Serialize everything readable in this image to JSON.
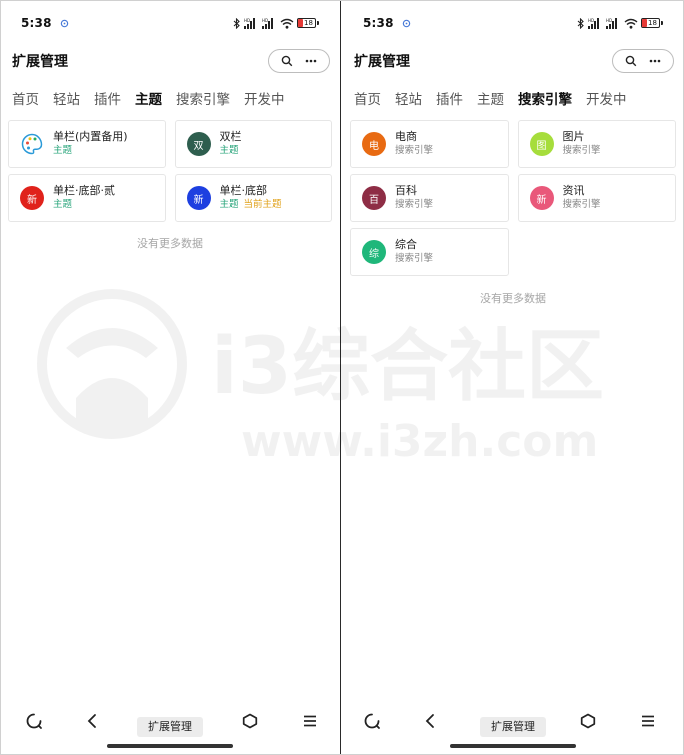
{
  "status_bar": {
    "time": "5:38",
    "battery": "18"
  },
  "app": {
    "title": "扩展管理"
  },
  "tabs": [
    "首页",
    "轻站",
    "插件",
    "主题",
    "搜索引擎",
    "开发中"
  ],
  "left_panel": {
    "active_tab": "主题",
    "cards": [
      {
        "name": "单栏(内置备用)",
        "sub": "主题",
        "icon": "palette-icon",
        "badge": ""
      },
      {
        "name": "双栏",
        "sub": "主题",
        "icon": "letter-badge",
        "badge": "双",
        "color": "#2e5e4e"
      },
      {
        "name": "单栏·底部·贰",
        "sub": "主题",
        "icon": "letter-badge",
        "badge": "新",
        "color": "#e0221b"
      },
      {
        "name": "单栏·底部",
        "sub": "主题",
        "current": "当前主题",
        "icon": "letter-badge",
        "badge": "新",
        "color": "#1d3fe0"
      }
    ],
    "no_more": "没有更多数据"
  },
  "right_panel": {
    "active_tab": "搜索引擎",
    "cards": [
      {
        "name": "电商",
        "sub": "搜索引擎",
        "badge": "电",
        "color": "#e86a12"
      },
      {
        "name": "图片",
        "sub": "搜索引擎",
        "badge": "图",
        "color": "#a6dd3c"
      },
      {
        "name": "百科",
        "sub": "搜索引擎",
        "badge": "百",
        "color": "#8e2d45"
      },
      {
        "name": "资讯",
        "sub": "搜索引擎",
        "badge": "新",
        "color": "#e9587a"
      },
      {
        "name": "综合",
        "sub": "搜索引擎",
        "badge": "综",
        "color": "#1fb77a"
      }
    ],
    "no_more": "没有更多数据"
  },
  "navbar": {
    "label": "扩展管理"
  },
  "watermark": {
    "text": "i3综合社区",
    "url": "www.i3zh.com"
  }
}
